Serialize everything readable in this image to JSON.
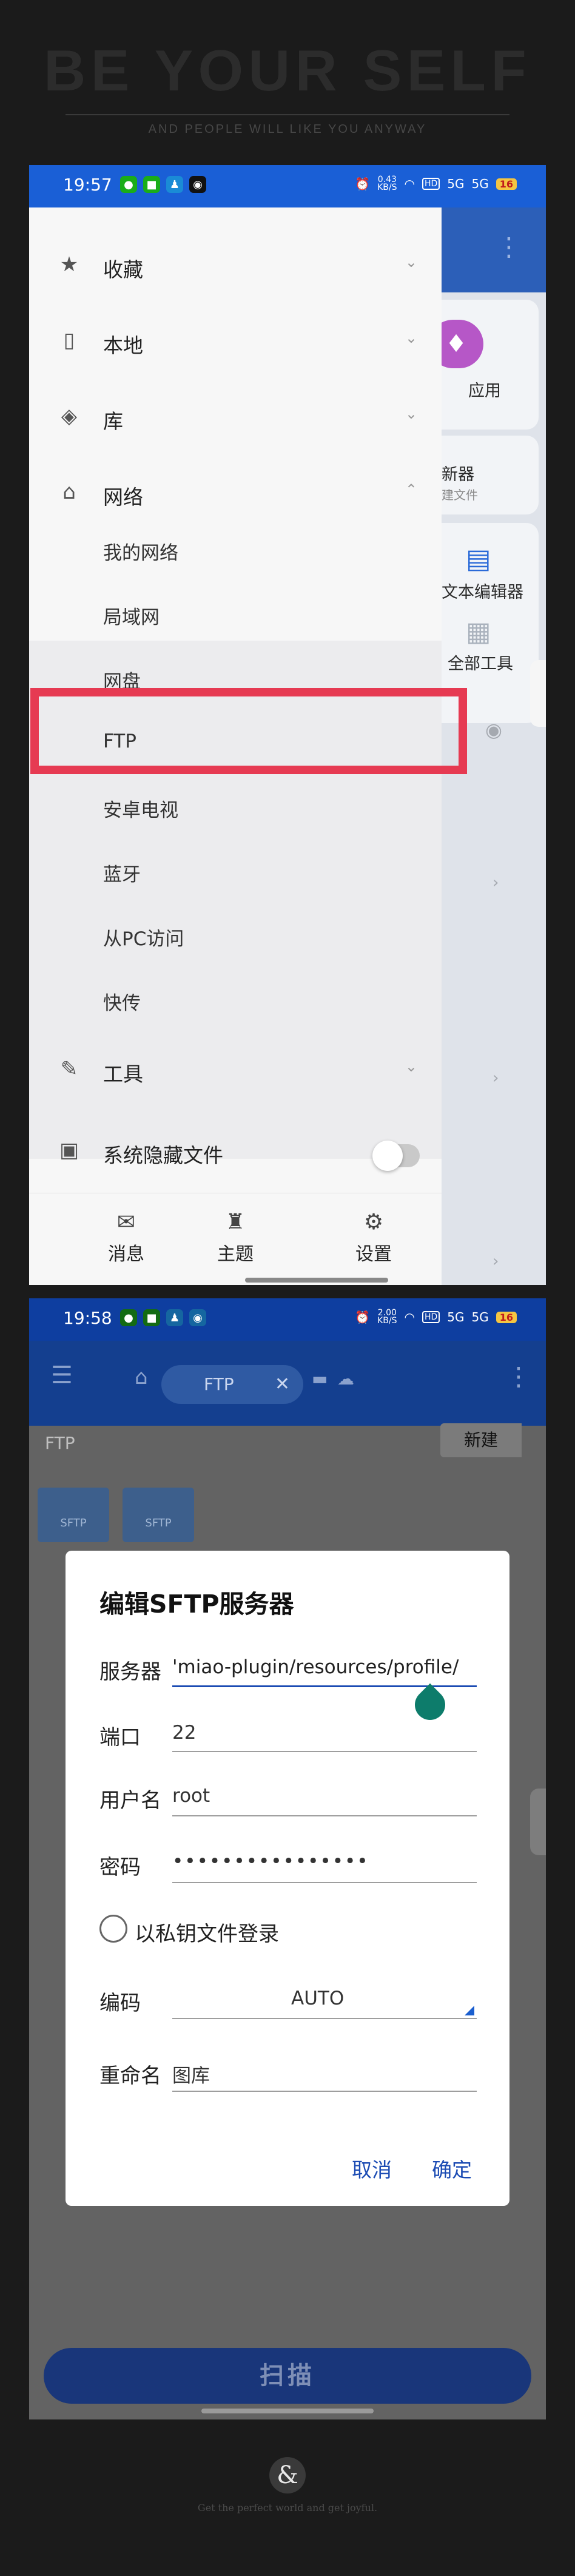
{
  "poster": {
    "title": "BE YOUR SELF",
    "subtitle": "AND PEOPLE WILL LIKE YOU ANYWAY"
  },
  "screen1": {
    "status_bar": {
      "time": "19:57",
      "net_speed": "0.43\nKB/S",
      "hd": "HD",
      "signal1": "5G",
      "signal2": "5G",
      "battery": "16"
    },
    "drawer": {
      "items": [
        {
          "label": "收藏",
          "icon": "star-icon"
        },
        {
          "label": "本地",
          "icon": "phone-icon"
        },
        {
          "label": "库",
          "icon": "layers-icon"
        },
        {
          "label": "网络",
          "icon": "router-icon"
        }
      ],
      "network_subitems": [
        "我的网络",
        "局域网",
        "网盘",
        "FTP",
        "安卓电视",
        "蓝牙",
        "从PC访问",
        "快传"
      ],
      "tools_label": "工具",
      "hidden_files_label": "系统隐藏文件",
      "hidden_files_toggle": false,
      "bottom_nav": [
        "消息",
        "主题",
        "设置"
      ]
    },
    "background": {
      "app_label": "应用",
      "card1_title": "新器",
      "card1_sub": "建文件",
      "text_editor": "文本编辑器",
      "all_tools": "全部工具"
    },
    "highlighted_item": "FTP"
  },
  "screen2": {
    "status_bar": {
      "time": "19:58",
      "net_speed": "2.00\nKB/S",
      "hd": "HD",
      "signal1": "5G",
      "signal2": "5G",
      "battery": "16"
    },
    "tab_label": "FTP",
    "path": "FTP",
    "new_button": "新建",
    "folders": [
      "SFTP",
      "SFTP"
    ],
    "scan_button": "扫描",
    "dialog": {
      "title": "编辑SFTP服务器",
      "server_label": "服务器",
      "server_value": "'miao-plugin/resources/profile/",
      "port_label": "端口",
      "port_value": "22",
      "username_label": "用户名",
      "username_value": "root",
      "password_label": "密码",
      "password_value": "••••••••••••••••",
      "private_key_label": "以私钥文件登录",
      "encoding_label": "编码",
      "encoding_value": "AUTO",
      "rename_label": "重命名",
      "rename_value": "图库",
      "cancel_button": "取消",
      "ok_button": "确定"
    }
  },
  "footer": {
    "logo": "&",
    "tagline": "Get the perfect world and get joyful."
  },
  "colors": {
    "status_bar_blue": "#1a5fd6",
    "highlight_red": "#e63a52",
    "link_blue": "#1b4bb3",
    "cursor_teal": "#0d7c6b"
  }
}
